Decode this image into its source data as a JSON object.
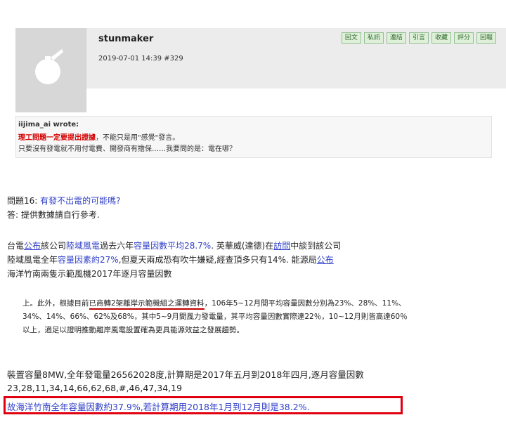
{
  "post": {
    "username": "stunmaker",
    "meta": "2019-07-01 14:39 #329",
    "actions": [
      "回文",
      "私訊",
      "連結",
      "引言",
      "收藏",
      "評分",
      "回報"
    ]
  },
  "quote": {
    "author": "iijima_ai wrote:",
    "line1_red": "理工問題一定要提出證據",
    "line1_rest": "，不能只是用\"感覺\"發言。",
    "line2": "只要沒有發電就不用付電費、開發商有擔保……我要問的是：電在哪？"
  },
  "question": {
    "label": "問題16: ",
    "text": "有發不出電的可能嗎?",
    "answer": "答: 提供數據請自行參考."
  },
  "para": {
    "l1_a": "台電",
    "l1_b": "公布",
    "l1_c": "該公司",
    "l1_d": "陸域風電",
    "l1_e": "過去六年",
    "l1_f": "容量因數平均28.7%",
    "l1_g": ". 英華威(達德)在",
    "l1_h": "訪問",
    "l1_i": "中談到該公司",
    "l2_a": "陸域風電全年",
    "l2_b": "容量因素約27%",
    "l2_c": ",但夏天兩成恐有吹牛嫌疑,經查頂多只有",
    "l2_d": "14%",
    "l2_e": ". 能源局",
    "l2_f": "公布",
    "l3": "海洋竹南兩隻示範風機2017年逐月容量因數"
  },
  "excerpt": {
    "l1_a": "上。此外，根據目前",
    "l1_b": "已商轉2架離岸示範機組之運轉資料",
    "l1_c": "，106年5~12月間平均容量因數分別為23%、28%、11%、",
    "l2": "34%、14%、66%、62%及68%，其中5~9月間風力發電量，其平均容量因數實際達22％，10~12月則皆高達60％",
    "l3": "以上，適足以證明推動離岸風電設置確為更具能源效益之發展趨勢。"
  },
  "stats": {
    "l1": "裝置容量8MW,全年發電量26562028度,計算期是2017年五月到2018年四月,逐月容量因數",
    "l2": "23,28,11,34,14,66,62,68,#,46,47,34,19",
    "conclusion": "故海洋竹南全年容量因數約37.9%,若計算期用2018年1月到12月則是38.2%."
  },
  "colors": {
    "link": "#3140c8",
    "emphasis_red": "#d40000",
    "highlight_border": "#e00010",
    "button_bg": "#dff0d8"
  }
}
